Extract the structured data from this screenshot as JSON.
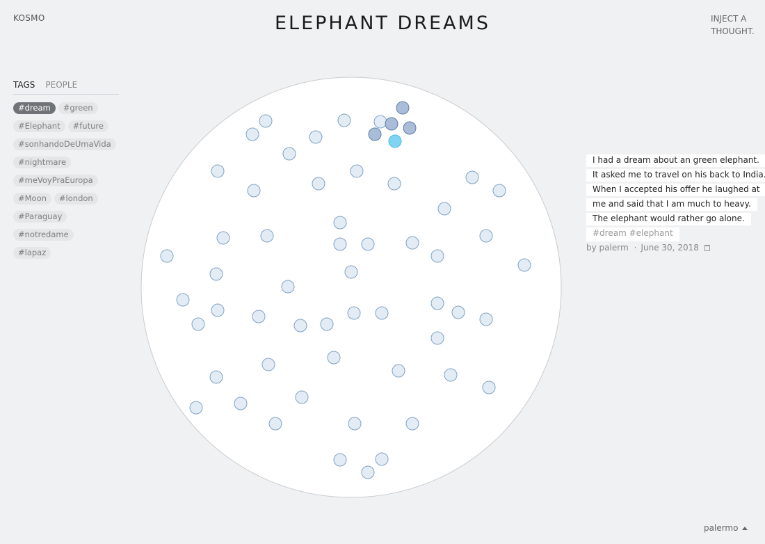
{
  "header": {
    "brand": "KOSMO",
    "title": "ELEPHANT DREAMS",
    "inject_line1": "INJECT A",
    "inject_line2": "THOUGHT."
  },
  "sidebar": {
    "tabs": [
      {
        "label": "TAGS",
        "active": true
      },
      {
        "label": "PEOPLE",
        "active": false
      }
    ],
    "tags": [
      {
        "label": "#dream",
        "active": true
      },
      {
        "label": "#green",
        "active": false
      },
      {
        "label": "#Elephant",
        "active": false
      },
      {
        "label": "#future",
        "active": false
      },
      {
        "label": "#sonhandoDeUmaVida",
        "active": false
      },
      {
        "label": "#nightmare",
        "active": false
      },
      {
        "label": "#meVoyPraEuropa",
        "active": false
      },
      {
        "label": "#Moon",
        "active": false
      },
      {
        "label": "#london",
        "active": false
      },
      {
        "label": "#Paraguay",
        "active": false
      },
      {
        "label": "#notredame",
        "active": false
      },
      {
        "label": "#lapaz",
        "active": false
      }
    ]
  },
  "dream": {
    "lines": [
      "I had a dream about an green elephant.",
      "It asked me to travel on his back to India.",
      "When I accepted his offer he laughed at",
      "me and said that I am much to heavy.",
      "The elephant would rather go alone."
    ],
    "tags": [
      "#dream",
      "#elephant"
    ],
    "author": "by palerm",
    "separator": "·",
    "date": "June 30, 2018",
    "delete_icon": "trash-icon"
  },
  "footer": {
    "user": "palermo"
  },
  "colors": {
    "background": "#f0f1f3",
    "bubble_fill": "#e3ecf4",
    "bubble_stroke": "#7da2c4",
    "bubble_highlight_fill": "#a9bdd9",
    "bubble_highlight_stroke": "#5b7ea8",
    "bubble_selected_fill": "#7fd4f3",
    "bubble_selected_stroke": "#4bb6e0",
    "active_tag": "#6f7377"
  },
  "bubbles": {
    "total": 61,
    "highlighted": 4,
    "selected": 1
  }
}
